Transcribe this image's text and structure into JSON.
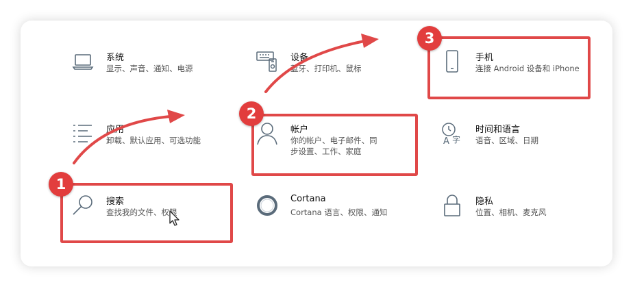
{
  "settings": {
    "system": {
      "title": "系统",
      "desc": "显示、声音、通知、电源",
      "icon": "laptop-icon"
    },
    "devices": {
      "title": "设备",
      "desc": "蓝牙、打印机、鼠标",
      "icon": "keyboard-icon"
    },
    "phone": {
      "title": "手机",
      "desc": "连接 Android 设备和 iPhone",
      "icon": "phone-icon"
    },
    "apps": {
      "title": "应用",
      "desc": "卸载、默认应用、可选功能",
      "icon": "list-icon"
    },
    "accounts": {
      "title": "帐户",
      "desc": "你的帐户、电子邮件、同步设置、工作、家庭",
      "icon": "person-icon"
    },
    "time": {
      "title": "时间和语言",
      "desc": "语音、区域、日期",
      "icon": "language-icon"
    },
    "search": {
      "title": "搜索",
      "desc": "查找我的文件、权限",
      "icon": "search-icon"
    },
    "cortana": {
      "title": "Cortana",
      "desc": "Cortana 语言、权限、通知",
      "icon": "cortana-icon"
    },
    "privacy": {
      "title": "隐私",
      "desc": "位置、相机、麦克风",
      "icon": "lock-icon"
    }
  },
  "annotations": {
    "badge1": "1",
    "badge2": "2",
    "badge3": "3",
    "color": "#e04848"
  }
}
